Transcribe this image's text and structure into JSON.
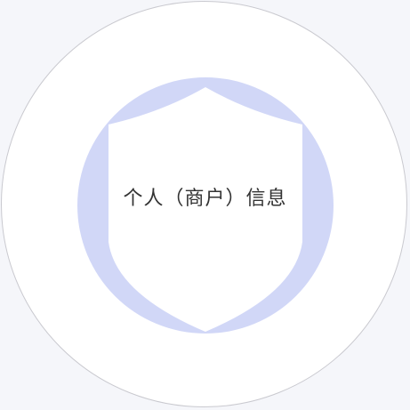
{
  "badge": {
    "label": "个人（商户）信息",
    "icon": "shield-icon"
  },
  "colors": {
    "background": "#f5f6fa",
    "circle_fill": "#ffffff",
    "circle_stroke": "#c9c9cf",
    "accent_disc": "#d1d7f7",
    "shield_fill": "#ffffff",
    "text": "#333333"
  }
}
